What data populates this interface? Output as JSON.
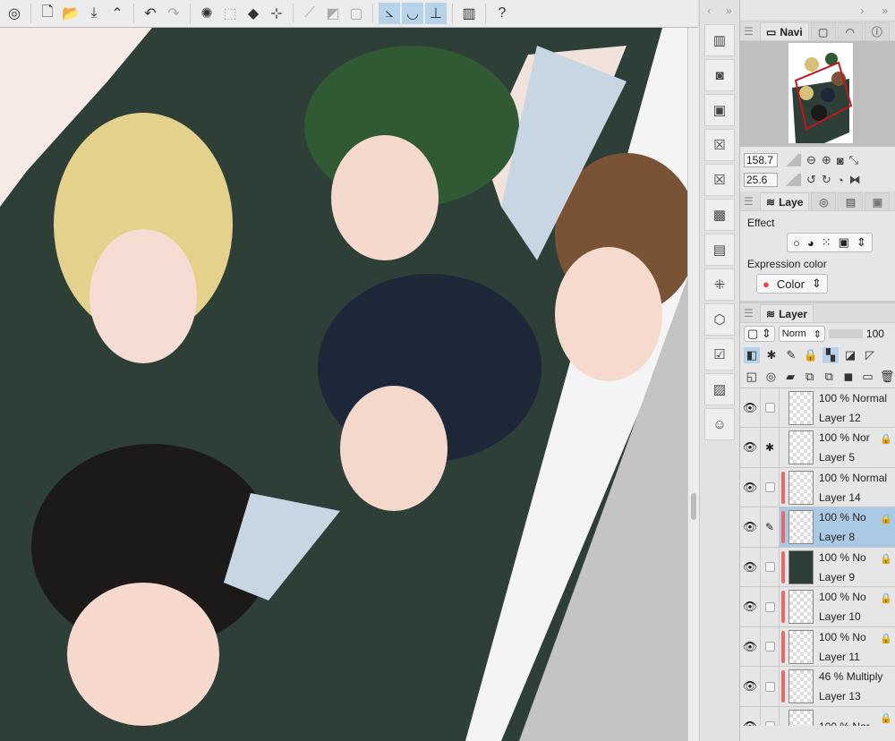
{
  "toolbar": {
    "items": [
      {
        "icon": "app-logo-icon",
        "glyph": "◎"
      },
      {
        "icon": "new-file-icon",
        "glyph": "🗋"
      },
      {
        "icon": "open-folder-icon",
        "glyph": "📂"
      },
      {
        "icon": "save-icon",
        "glyph": "⤓"
      },
      {
        "icon": "more-chevron-icon",
        "glyph": "⌃"
      },
      {
        "icon": "undo-icon",
        "glyph": "↶"
      },
      {
        "icon": "redo-icon",
        "glyph": "↷"
      },
      {
        "icon": "clear-selection-icon",
        "glyph": "✺"
      },
      {
        "icon": "selection-transform-icon",
        "glyph": "⬚"
      },
      {
        "icon": "fill-icon",
        "glyph": "◆"
      },
      {
        "icon": "transform-icon",
        "glyph": "⊹"
      },
      {
        "icon": "ruler-snap-icon",
        "glyph": "⟋"
      },
      {
        "icon": "grid-snap-icon",
        "glyph": "◩"
      },
      {
        "icon": "frame-icon",
        "glyph": "▢"
      },
      {
        "icon": "snap-ruler-icon",
        "glyph": "⦣"
      },
      {
        "icon": "snap-special-ruler-icon",
        "glyph": "◡"
      },
      {
        "icon": "snap-grid-icon",
        "glyph": "⊥"
      },
      {
        "icon": "companion-device-icon",
        "glyph": "▥"
      },
      {
        "icon": "help-icon",
        "glyph": "?"
      }
    ]
  },
  "strip": {
    "collapse_left": "‹",
    "collapse_right": "»",
    "items": [
      "▥",
      "◙",
      "▣",
      "☒",
      "☒",
      "▩",
      "▤",
      "⁜",
      "⬡",
      "☑",
      "▨",
      "☺"
    ]
  },
  "panel": {
    "header_arrows": [
      "›",
      "»"
    ],
    "navigator": {
      "tab": "Navi",
      "zoom": "158.7",
      "rotation": "25.6"
    },
    "layer_property": {
      "tab": "Laye",
      "effect_label": "Effect",
      "expression_label": "Expression color",
      "expression_value": "Color"
    },
    "layer": {
      "tab": "Layer",
      "blend_mode": "Norm",
      "opacity": "100",
      "layers": [
        {
          "opacity": "100 %",
          "mode": "Normal",
          "name": "Layer 12",
          "col2": "checkbox",
          "clip": false,
          "lock": false,
          "thumb": "empty"
        },
        {
          "opacity": "100 %",
          "mode": "Nor",
          "name": "Layer 5",
          "col2": "reference",
          "clip": false,
          "lock": true,
          "thumb": "empty"
        },
        {
          "opacity": "100 %",
          "mode": "Normal",
          "name": "Layer 14",
          "col2": "checkbox",
          "clip": true,
          "lock": false,
          "thumb": "empty"
        },
        {
          "opacity": "100 %",
          "mode": "No",
          "name": "Layer 8",
          "col2": "pen",
          "clip": true,
          "lock": true,
          "thumb": "art",
          "active": true
        },
        {
          "opacity": "100 %",
          "mode": "No",
          "name": "Layer 9",
          "col2": "checkbox",
          "clip": true,
          "lock": true,
          "thumb": "dark"
        },
        {
          "opacity": "100 %",
          "mode": "No",
          "name": "Layer 10",
          "col2": "checkbox",
          "clip": true,
          "lock": true,
          "thumb": "empty"
        },
        {
          "opacity": "100 %",
          "mode": "No",
          "name": "Layer 11",
          "col2": "checkbox",
          "clip": true,
          "lock": true,
          "thumb": "empty"
        },
        {
          "opacity": "46 %",
          "mode": "Multiply",
          "name": "Layer 13",
          "col2": "checkbox",
          "clip": true,
          "lock": false,
          "thumb": "empty"
        },
        {
          "opacity": "100 %",
          "mode": "Nor",
          "name": "",
          "col2": "checkbox",
          "clip": false,
          "lock": true,
          "thumb": "empty"
        }
      ]
    }
  }
}
